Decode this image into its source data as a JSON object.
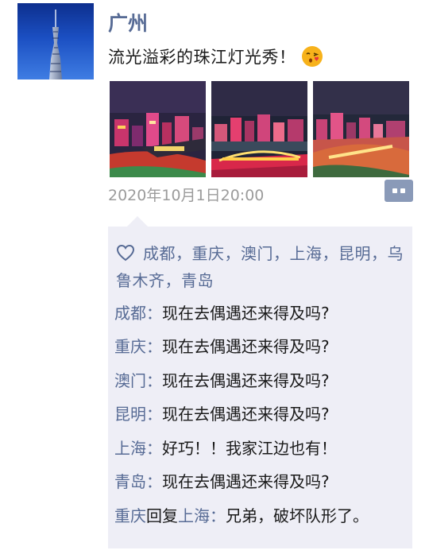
{
  "post": {
    "author": "广州",
    "text": "流光溢彩的珠江灯光秀！",
    "emoji_icon": "kissing-face-emoji",
    "timestamp": "2020年10月1日20:00",
    "photo_count": 3
  },
  "likes": {
    "icon": "heart-outline-icon",
    "names_text": "成都，重庆，澳门，上海，昆明，乌鲁木齐，青岛"
  },
  "comments": [
    {
      "name": "成都",
      "sep": "：",
      "text": "现在去偶遇还来得及吗?"
    },
    {
      "name": "重庆",
      "sep": "：",
      "text": "现在去偶遇还来得及吗?"
    },
    {
      "name": "澳门",
      "sep": "：",
      "text": "现在去偶遇还来得及吗?"
    },
    {
      "name": "昆明",
      "sep": "：",
      "text": "现在去偶遇还来得及吗?"
    },
    {
      "name": "上海",
      "sep": "：",
      "text": "好巧！！我家江边也有！"
    },
    {
      "name": "青岛",
      "sep": "：",
      "text": "现在去偶遇还来得及吗?"
    }
  ],
  "reply": {
    "from": "重庆",
    "reply_word": "回复",
    "to": "上海",
    "sep": "：",
    "text": "兄弟，破坏队形了。"
  },
  "colors": {
    "link": "#576b95",
    "timestamp": "#9b9b9b",
    "comment_bg": "#eeeef6",
    "more_button": "#8a9ab8"
  }
}
